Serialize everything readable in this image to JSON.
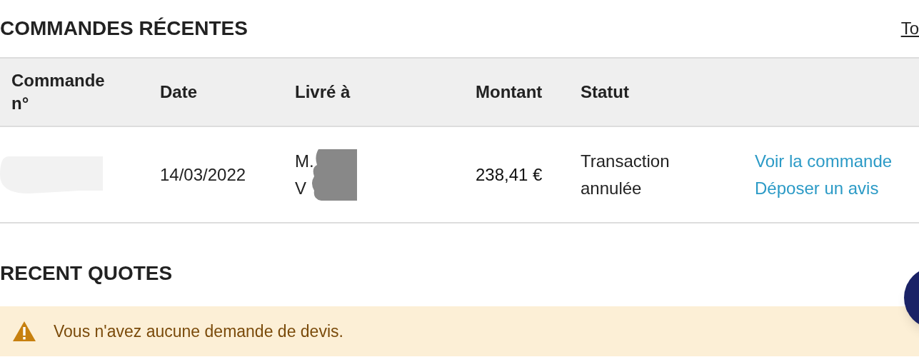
{
  "orders": {
    "title": "COMMANDES RÉCENTES",
    "view_all_link": "To",
    "columns": [
      "Commande n°",
      "Date",
      "Livré à",
      "Montant",
      "Statut"
    ],
    "rows": [
      {
        "date": "14/03/2022",
        "recipient": [
          "M.",
          "V"
        ],
        "amount": "238,41 €",
        "status": "Transaction annulée",
        "actions": [
          "Voir la commande",
          "Déposer un avis"
        ]
      }
    ]
  },
  "quotes": {
    "title": "RECENT QUOTES",
    "alert": {
      "kind": "warning",
      "message": "Vous n'avez aucune demande de devis."
    }
  }
}
